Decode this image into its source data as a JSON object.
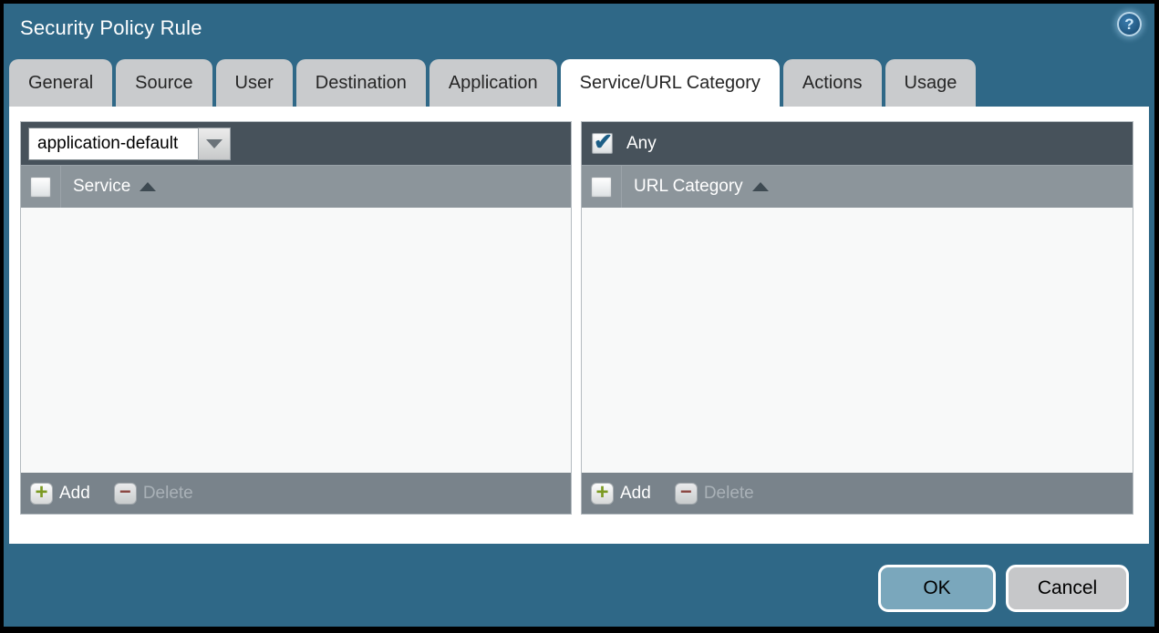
{
  "window": {
    "title": "Security Policy Rule"
  },
  "help_icon_glyph": "?",
  "tabs": [
    {
      "label": "General",
      "active": false
    },
    {
      "label": "Source",
      "active": false
    },
    {
      "label": "User",
      "active": false
    },
    {
      "label": "Destination",
      "active": false
    },
    {
      "label": "Application",
      "active": false
    },
    {
      "label": "Service/URL Category",
      "active": true
    },
    {
      "label": "Actions",
      "active": false
    },
    {
      "label": "Usage",
      "active": false
    }
  ],
  "service_panel": {
    "dropdown": {
      "value": "application-default"
    },
    "header": {
      "label": "Service",
      "sort": "asc",
      "checkbox_checked": false
    },
    "rows": [],
    "footer": {
      "add_label": "Add",
      "delete_label": "Delete",
      "delete_enabled": false
    }
  },
  "url_category_panel": {
    "any": {
      "label": "Any",
      "checked": true
    },
    "header": {
      "label": "URL Category",
      "sort": "asc",
      "checkbox_checked": false
    },
    "rows": [],
    "footer": {
      "add_label": "Add",
      "delete_label": "Delete",
      "delete_enabled": false
    }
  },
  "dialog_buttons": {
    "ok": "OK",
    "cancel": "Cancel"
  },
  "icon_glyphs": {
    "add": "+",
    "delete": "−"
  },
  "colors": {
    "dialog_background": "#2F6887",
    "frame_border": "#000000",
    "toolbar_row": "#47525B",
    "header_row": "#8C959B",
    "footer_row": "#79838B",
    "ok_button": "#7AA7BC",
    "cancel_button": "#C6C7C9",
    "add_icon_green": "#7C9A23",
    "delete_icon_red": "#8C3B34",
    "checkmark_blue": "#1C5E86"
  }
}
